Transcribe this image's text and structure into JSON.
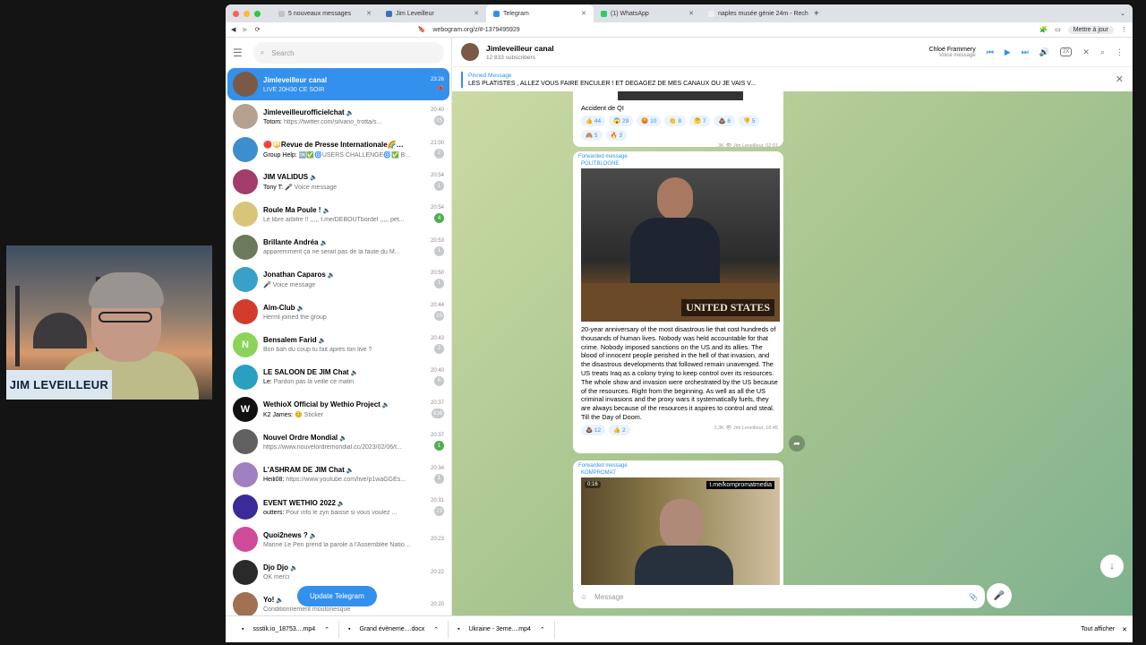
{
  "webcam": {
    "name": "JIM LEVEILLEUR"
  },
  "browser": {
    "tabs": [
      {
        "label": "5 nouveaux messages",
        "color": "#c2c2c2"
      },
      {
        "label": "Jim Leveilleur",
        "color": "#3b70c8"
      },
      {
        "label": "Telegram",
        "color": "#3390ec"
      },
      {
        "label": "(1) WhatsApp",
        "color": "#25d366"
      },
      {
        "label": "naples musée génie 24m - Recher...",
        "color": "#eeeeee"
      }
    ],
    "url": "webogram.org/z/#-1379495929",
    "update_label": "Mettre à jour"
  },
  "sidebar": {
    "search_placeholder": "Search",
    "update_button": "Update Telegram",
    "chats": [
      {
        "name": "Jimleveilleur canal",
        "preview": "LIVE 20H30 CE SOIR",
        "sender": "",
        "time": "23:26",
        "badge": "",
        "color": "#7a5a45",
        "initials": "",
        "active": true
      },
      {
        "name": "Jimleveilleurofficielchat",
        "preview": "https://twitter.com/silvano_trotta/s...",
        "sender": "Totom: ",
        "time": "20:40",
        "badge": "15",
        "color": "#b6a090",
        "initials": "",
        "active": false
      },
      {
        "name": "🔴🔱Revue de Presse Internationale🌈🙏 4...",
        "preview": "🆗✅🌀USERS CHALLENGE🌀✅ Bravo ...",
        "sender": "Group Help: ",
        "time": "21:00",
        "badge": "2",
        "color": "#3d8ecf",
        "initials": "",
        "active": false
      },
      {
        "name": "JIM VALIDUS",
        "preview": "🎤 Voice message",
        "sender": "Tony T: ",
        "time": "20:54",
        "badge": "1",
        "color": "#a23c6a",
        "initials": "",
        "active": false
      },
      {
        "name": "Roule Ma Poule !",
        "preview": "Le libre arbitre !! ,,,,, t.me/DEBOUTbordel ,,,,, pet...",
        "sender": "",
        "time": "20:54",
        "badge": "4",
        "badge_green": true,
        "color": "#d9c57a",
        "initials": "",
        "active": false
      },
      {
        "name": "Brillante Andréa",
        "preview": "apparemment ça ne serait pas de la faute du M...",
        "sender": "",
        "time": "20:53",
        "badge": "1",
        "color": "#6a7a5a",
        "initials": "",
        "active": false
      },
      {
        "name": "Jonathan Caparos",
        "preview": "🎤 Voice message",
        "sender": "",
        "time": "20:50",
        "badge": "1",
        "color": "#3aa0c8",
        "initials": "",
        "active": false
      },
      {
        "name": "Aim-Club",
        "preview": "Herml joined the group",
        "sender": "",
        "time": "20:44",
        "badge": "15",
        "color": "#d33c2c",
        "initials": "",
        "active": false
      },
      {
        "name": "Bensalem Farid",
        "preview": "Bon bah du coup tu fait après ton live ?",
        "sender": "",
        "time": "20:43",
        "badge": "2",
        "color": "#8bd35a",
        "initials": "N",
        "active": false
      },
      {
        "name": "LE SALOON DE JIM Chat",
        "preview": "Pardon pas la veille ce matin",
        "sender": "Le: ",
        "time": "20:40",
        "badge": "6",
        "color": "#2a9fc0",
        "initials": "",
        "active": false
      },
      {
        "name": "WethioX Official by Wethio Project",
        "preview": "😊 Sticker",
        "sender": "K2 James: ",
        "time": "20:37",
        "badge": "836",
        "color": "#111111",
        "initials": "W",
        "active": false
      },
      {
        "name": "Nouvel Ordre Mondial",
        "preview": "https://www.nouvelordremondial.cc/2023/02/06/t...",
        "sender": "",
        "time": "20:37",
        "badge": "1",
        "badge_green": true,
        "color": "#606060",
        "initials": "",
        "active": false
      },
      {
        "name": "L'ASHRAM DE JIM Chat",
        "preview": "https://www.youtube.com/live/p1waGGEs...",
        "sender": "Heili08: ",
        "time": "20:34",
        "badge": "1",
        "color": "#a080c0",
        "initials": "",
        "active": false
      },
      {
        "name": "EVENT WETHIO 2022",
        "preview": "Pour info le zyn baisse si vous voulez ...",
        "sender": "outters: ",
        "time": "20:31",
        "badge": "23",
        "color": "#3a2a9a",
        "initials": "",
        "active": false
      },
      {
        "name": "Quoi2news ?",
        "preview": "Marine Le Pen prend la parole à l'Assemblée Nationa...",
        "sender": "",
        "time": "20:23",
        "badge": "",
        "color": "#d04a9a",
        "initials": "",
        "active": false
      },
      {
        "name": "Djo Djo",
        "preview": "OK merci",
        "sender": "",
        "time": "20:22",
        "badge": "",
        "color": "#2a2a2a",
        "initials": "",
        "active": false
      },
      {
        "name": "Yo!",
        "preview": "Conditionnement moutonesque",
        "sender": "",
        "time": "20:20",
        "badge": "",
        "color": "#a07050",
        "initials": "",
        "active": false
      }
    ]
  },
  "main": {
    "channel_title": "Jimleveilleur canal",
    "subscribers": "12 833 subscribers",
    "player_name": "Chloé Frammery",
    "player_sub": "Voice message",
    "speed": "2X",
    "pinned_label": "Pinned Message",
    "pinned_text": "LES PLATISTES , ALLEZ VOUS FAIRE ENCULER ! ET DEGAGEZ DE MES CANAUX OU JE VAIS V...",
    "msg1": {
      "text": "Accident de QI",
      "reactions": [
        "👍 44",
        "😱 29",
        "😡 10",
        "👏 8",
        "🤔 7",
        "💩 6",
        "👎 5",
        "🙈 5",
        "🔥 3"
      ],
      "meta": "3K 👁 Jim Leveilleur, 02:01"
    },
    "msg2": {
      "forwarded": "Forwarded message",
      "source": "POLITBLOGNE",
      "sign": "UNITED STATES",
      "text": "20-year anniversary of the most disastrous lie that cost hundreds of thousands of human lives. Nobody was held accountable for that crime. Nobody imposed sanctions on the US and its allies. The blood of innocent people perished in the hell of that invasion, and the disastrous developments that followed remain unavenged. The US treats Iraq as a colony trying to keep control over its resources. The whole show and invasion were orchestrated by the US because of the resources. Right from the beginning. As well as all the US criminal invasions and the proxy wars it systematically fuels, they are always because of the resources it aspires to control and steal. Till the Day of Doom.",
      "reactions": [
        "💩 12",
        "👍 2"
      ],
      "meta": "2,3K 👁 Jim Leveilleur, 18:45"
    },
    "msg3": {
      "forwarded": "Forwarded message",
      "source": "KOMPROMAT",
      "duration": "0:16",
      "watermark": "t.me/kompromatmedia"
    },
    "composer_placeholder": "Message"
  },
  "downloads": {
    "items": [
      "ssstik.io_18753....mp4",
      "Grand évèneme....docx",
      "Ukraine - 3eme....mp4"
    ],
    "show_all": "Tout afficher"
  }
}
